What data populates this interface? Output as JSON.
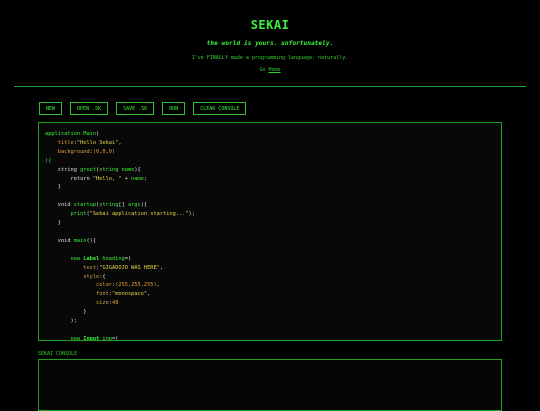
{
  "header": {
    "title": "SEKAI",
    "tagline": "the world is yours. unfortunately.",
    "description": "I've FINALLY made a programming language. naturally.",
    "go_prefix": "Go",
    "home_link": "Home"
  },
  "toolbar": {
    "new_label": "NEW",
    "open_label": "OPEN .SK",
    "save_label": "SAVE .SK",
    "run_label": "RUN",
    "clear_label": "CLEAR CONSOLE"
  },
  "editor": {
    "lines": [
      [
        [
          "kw",
          "application "
        ],
        [
          "kw",
          "Main"
        ],
        [
          "ident",
          "("
        ]
      ],
      [
        [
          "ident",
          "    "
        ],
        [
          "prop",
          "title"
        ],
        [
          "ident",
          ":"
        ],
        [
          "str",
          "\"Hello Sekai\""
        ],
        [
          "ident",
          ","
        ]
      ],
      [
        [
          "ident",
          "    "
        ],
        [
          "prop",
          "background"
        ],
        [
          "ident",
          ":"
        ],
        [
          "num",
          "(0,0,0)"
        ]
      ],
      [
        [
          "kw",
          "){"
        ]
      ],
      [
        [
          "ident",
          "    "
        ],
        [
          "ident",
          "string "
        ],
        [
          "kw",
          "greet"
        ],
        [
          "ident",
          "("
        ],
        [
          "kw",
          "string "
        ],
        [
          "kw",
          "name"
        ],
        [
          "ident",
          "){"
        ]
      ],
      [
        [
          "ident",
          "        "
        ],
        [
          "ident",
          "return "
        ],
        [
          "str",
          "\"Hello, \""
        ],
        [
          "ident",
          " + "
        ],
        [
          "kw",
          "name"
        ],
        [
          "ident",
          ";"
        ]
      ],
      [
        [
          "ident",
          "    }"
        ]
      ],
      [
        [
          "ident",
          ""
        ]
      ],
      [
        [
          "ident",
          "    "
        ],
        [
          "ident",
          "void "
        ],
        [
          "kw",
          "startup"
        ],
        [
          "ident",
          "("
        ],
        [
          "kw",
          "string"
        ],
        [
          "ident",
          "[] "
        ],
        [
          "kw",
          "args"
        ],
        [
          "ident",
          "){"
        ]
      ],
      [
        [
          "ident",
          "        "
        ],
        [
          "kw",
          "print"
        ],
        [
          "ident",
          "("
        ],
        [
          "str",
          "\"Sekai application starting...\""
        ],
        [
          "ident",
          ");"
        ]
      ],
      [
        [
          "ident",
          "    }"
        ]
      ],
      [
        [
          "ident",
          ""
        ]
      ],
      [
        [
          "ident",
          "    "
        ],
        [
          "ident",
          "void "
        ],
        [
          "kw",
          "main"
        ],
        [
          "ident",
          "(){"
        ]
      ],
      [
        [
          "ident",
          ""
        ]
      ],
      [
        [
          "ident",
          "        "
        ],
        [
          "kw",
          "new "
        ],
        [
          "cls",
          "Label "
        ],
        [
          "kw",
          "heading"
        ],
        [
          "ident",
          "=("
        ]
      ],
      [
        [
          "ident",
          "            "
        ],
        [
          "prop",
          "text"
        ],
        [
          "ident",
          ":"
        ],
        [
          "str",
          "\"GIGADOJO WAS HERE\""
        ],
        [
          "ident",
          ","
        ]
      ],
      [
        [
          "ident",
          "            "
        ],
        [
          "prop",
          "style"
        ],
        [
          "ident",
          ":{"
        ]
      ],
      [
        [
          "ident",
          "                "
        ],
        [
          "prop",
          "color"
        ],
        [
          "ident",
          ":"
        ],
        [
          "num",
          "(255,255,255)"
        ],
        [
          "ident",
          ","
        ]
      ],
      [
        [
          "ident",
          "                "
        ],
        [
          "prop",
          "font"
        ],
        [
          "ident",
          ":"
        ],
        [
          "str",
          "\"monospace\""
        ],
        [
          "ident",
          ","
        ]
      ],
      [
        [
          "ident",
          "                "
        ],
        [
          "prop",
          "size"
        ],
        [
          "ident",
          ":"
        ],
        [
          "num",
          "48"
        ]
      ],
      [
        [
          "ident",
          "            }"
        ]
      ],
      [
        [
          "ident",
          "        );"
        ]
      ],
      [
        [
          "ident",
          ""
        ]
      ],
      [
        [
          "ident",
          "        "
        ],
        [
          "kw",
          "new "
        ],
        [
          "cls",
          "Input "
        ],
        [
          "kw",
          "inp"
        ],
        [
          "ident",
          "=("
        ]
      ]
    ]
  },
  "console": {
    "label": "SEKAI CONSOLE",
    "output": ""
  },
  "colors": {
    "accent": "#3cf03c",
    "border": "#1f9f1f",
    "background": "#000000",
    "string": "#e8d84a",
    "number": "#e8a03a"
  }
}
